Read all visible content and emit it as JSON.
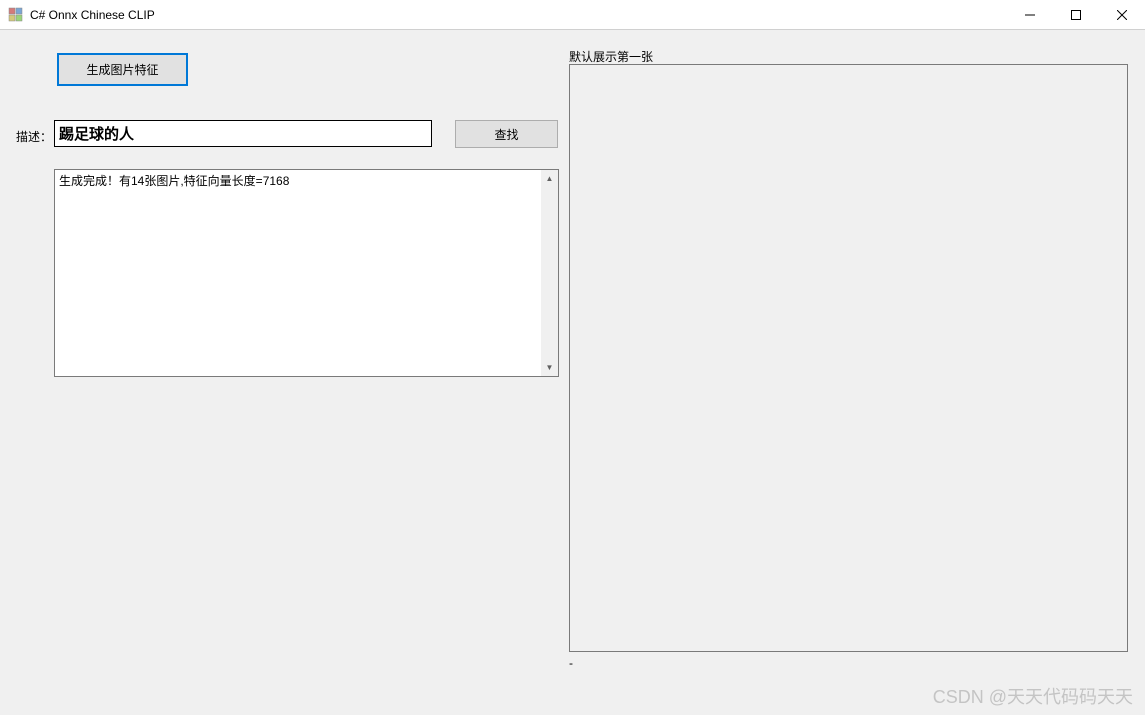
{
  "window": {
    "title": "C# Onnx Chinese CLIP"
  },
  "buttons": {
    "generate": "生成图片特征",
    "search": "查找"
  },
  "labels": {
    "description": "描述：",
    "preview": "默认展示第一张",
    "dash": "-"
  },
  "inputs": {
    "description_value": "踢足球的人"
  },
  "log": {
    "text": "生成完成！有14张图片,特征向量长度=7168"
  },
  "watermark": "CSDN @天天代码码天天"
}
